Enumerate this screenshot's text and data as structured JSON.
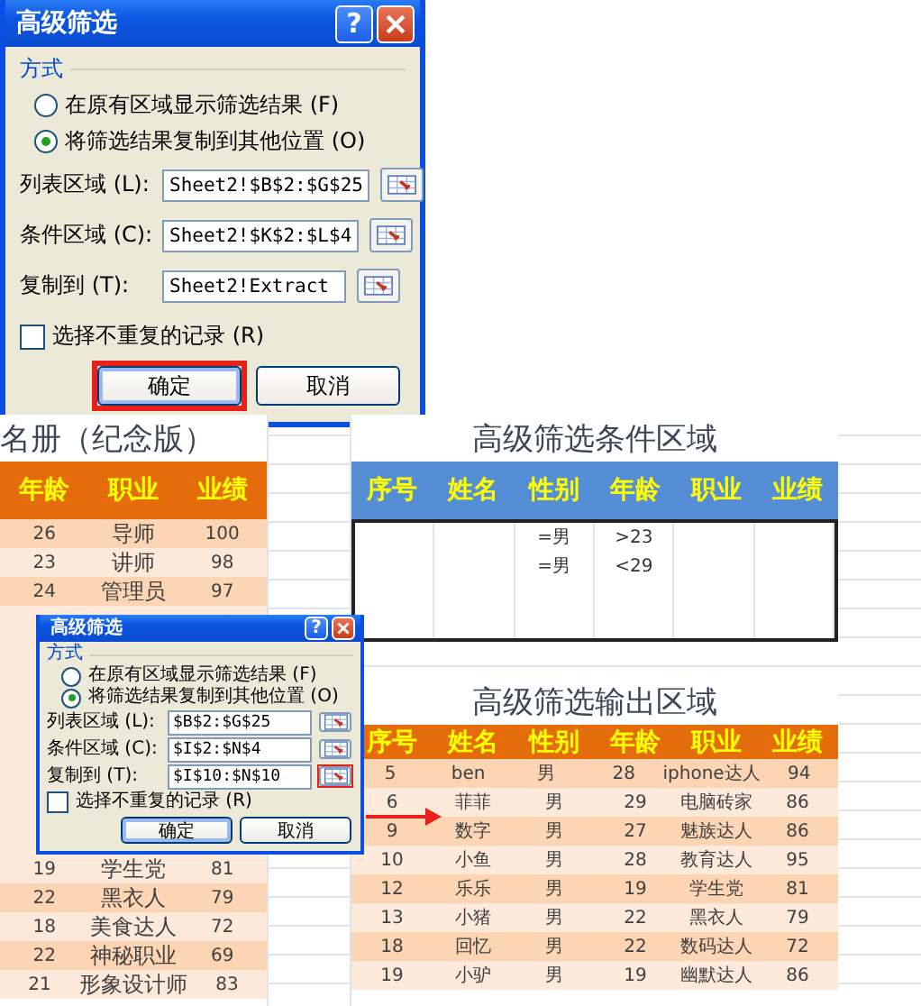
{
  "dialog": {
    "title": "高级筛选",
    "help": "?",
    "group_label": "方式",
    "options": [
      {
        "label": "在原有区域显示筛选结果 (F)",
        "selected": false
      },
      {
        "label": "将筛选结果复制到其他位置 (O)",
        "selected": true
      }
    ],
    "fields": [
      {
        "label": "列表区域 (L):",
        "value": "Sheet2!$B$2:$G$25",
        "highlighted": false
      },
      {
        "label": "条件区域 (C):",
        "value": "Sheet2!$K$2:$L$4",
        "highlighted": false
      },
      {
        "label": "复制到 (T):",
        "value": "Sheet2!Extract",
        "highlighted": false
      }
    ],
    "checkbox": {
      "label": "选择不重复的记录 (R)",
      "checked": false
    },
    "buttons": [
      {
        "label": "确定",
        "highlighted": true
      },
      {
        "label": "取消",
        "highlighted": false
      }
    ]
  },
  "sheet": {
    "roster": {
      "title": "名册（纪念版）",
      "columns": [
        "年龄",
        "职业",
        "业绩"
      ],
      "rows_above": [
        [
          "26",
          "导师",
          "100"
        ],
        [
          "23",
          "讲师",
          "98"
        ],
        [
          "24",
          "管理员",
          "97"
        ]
      ],
      "rows_below": [
        [
          "19",
          "学生党",
          "81"
        ],
        [
          "22",
          "黑衣人",
          "79"
        ],
        [
          "18",
          "美食达人",
          "72"
        ],
        [
          "22",
          "神秘职业",
          "69"
        ],
        [
          "21",
          "形象设计师",
          "83"
        ]
      ]
    },
    "criteria": {
      "title": "高级筛选条件区域",
      "columns": [
        "序号",
        "姓名",
        "性别",
        "年龄",
        "职业",
        "业绩"
      ],
      "rows": [
        {
          "gender": "=男",
          "age": ">23"
        },
        {
          "gender": "=男",
          "age": "<29"
        }
      ]
    },
    "output": {
      "title": "高级筛选输出区域",
      "columns": [
        "序号",
        "姓名",
        "性别",
        "年龄",
        "职业",
        "业绩"
      ],
      "rows": [
        [
          "5",
          "ben",
          "男",
          "28",
          "iphone达人",
          "94"
        ],
        [
          "6",
          "菲菲",
          "男",
          "29",
          "电脑砖家",
          "86"
        ],
        [
          "9",
          "数字",
          "男",
          "27",
          "魅族达人",
          "86"
        ],
        [
          "10",
          "小鱼",
          "男",
          "28",
          "教育达人",
          "95"
        ],
        [
          "12",
          "乐乐",
          "男",
          "19",
          "学生党",
          "81"
        ],
        [
          "13",
          "小猪",
          "男",
          "22",
          "黑衣人",
          "79"
        ],
        [
          "18",
          "回忆",
          "男",
          "22",
          "数码达人",
          "72"
        ],
        [
          "19",
          "小驴",
          "男",
          "19",
          "幽默达人",
          "86"
        ]
      ]
    },
    "small_dialog": {
      "title": "高级筛选",
      "help": "?",
      "group_label": "方式",
      "options": [
        {
          "label": "在原有区域显示筛选结果 (F)",
          "selected": false
        },
        {
          "label": "将筛选结果复制到其他位置 (O)",
          "selected": true
        }
      ],
      "fields": [
        {
          "label": "列表区域 (L):",
          "value": "$B$2:$G$25",
          "highlighted": false
        },
        {
          "label": "条件区域 (C):",
          "value": "$I$2:$N$4",
          "highlighted": false
        },
        {
          "label": "复制到 (T):",
          "value": "$I$10:$N$10",
          "highlighted": true
        }
      ],
      "checkbox": {
        "label": "选择不重复的记录 (R)",
        "checked": false
      },
      "buttons": [
        {
          "label": "确定",
          "highlighted": false
        },
        {
          "label": "取消",
          "highlighted": false
        }
      ]
    }
  }
}
